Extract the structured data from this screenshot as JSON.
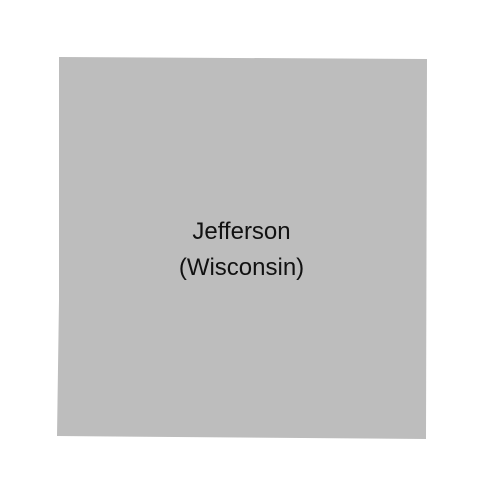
{
  "map": {
    "county_name": "Jefferson",
    "state_label": "(Wisconsin)",
    "fill_color": "#bdbdbd",
    "background_color": "#ffffff",
    "label_color": "#111111"
  }
}
